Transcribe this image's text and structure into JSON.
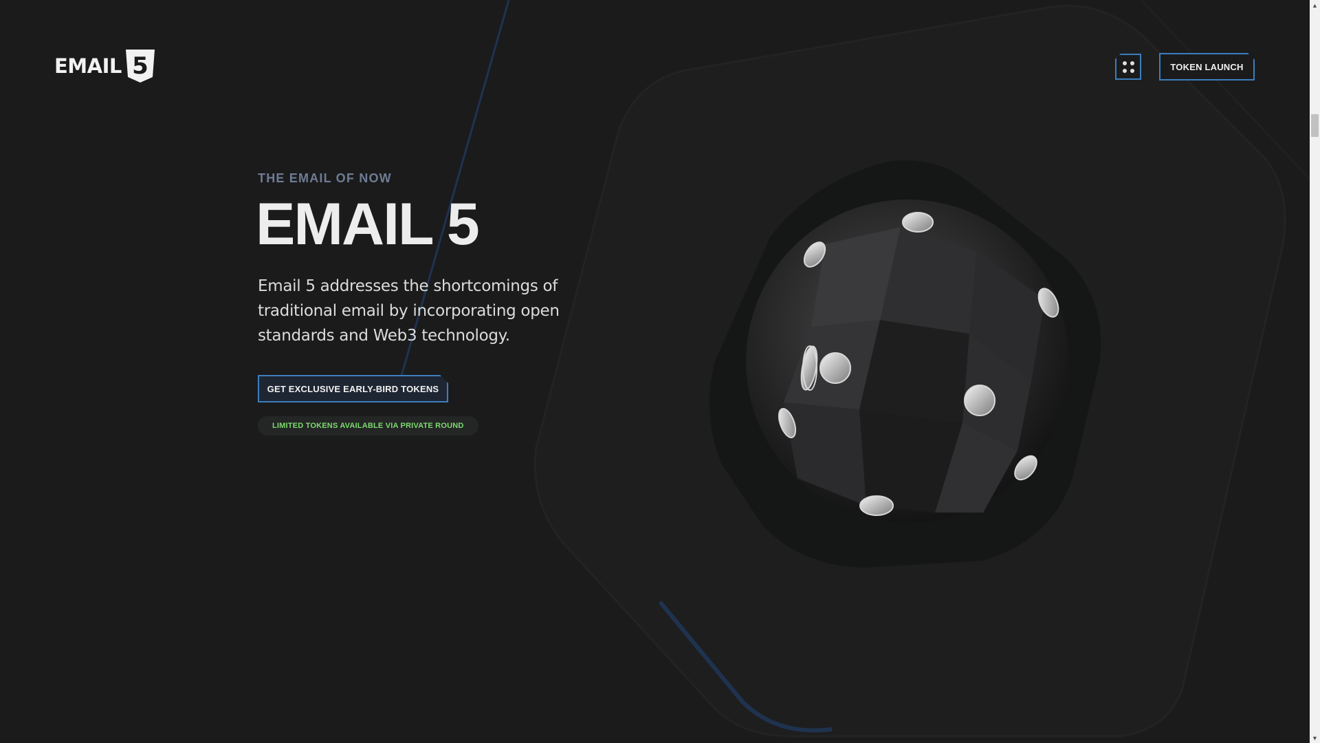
{
  "header": {
    "logo_text": "EMAIL",
    "logo_badge": "5",
    "menu_icon": "grid-dots-icon",
    "token_button_label": "TOKEN LAUNCH"
  },
  "hero": {
    "eyebrow": "THE EMAIL OF NOW",
    "title": "EMAIL 5",
    "description": "Email 5 addresses the shortcomings of traditional email by incorporating open standards and Web3 technology.",
    "cta_label": "GET EXCLUSIVE EARLY-BIRD TOKENS",
    "badge_text": "LIMITED TOKENS AVAILABLE VIA PRIVATE ROUND",
    "art_name": "dodecahedron-sphere-illustration"
  },
  "colors": {
    "background": "#1b1b1c",
    "accent_blue": "#3b7fc0",
    "eyebrow": "#6f7c95",
    "badge_green": "#7ddb6f"
  }
}
